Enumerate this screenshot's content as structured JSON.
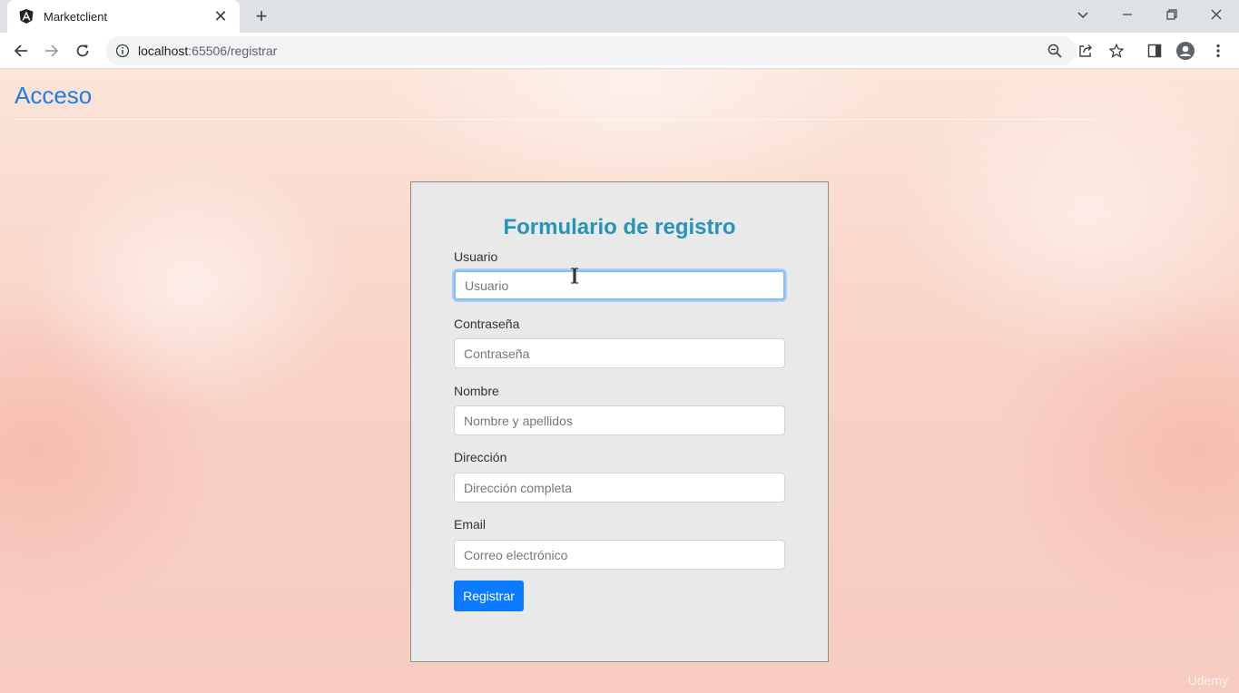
{
  "browser": {
    "tab_title": "Marketclient",
    "tab_close": "✕",
    "new_tab": "+",
    "url_host": "localhost",
    "url_rest": ":65506/registrar"
  },
  "nav": {
    "brand_link": "Acceso"
  },
  "form": {
    "title": "Formulario de registro",
    "fields": [
      {
        "label": "Usuario",
        "placeholder": "Usuario",
        "value": ""
      },
      {
        "label": "Contraseña",
        "placeholder": "Contraseña",
        "value": ""
      },
      {
        "label": "Nombre",
        "placeholder": "Nombre y apellidos",
        "value": ""
      },
      {
        "label": "Dirección",
        "placeholder": "Dirección completa",
        "value": ""
      },
      {
        "label": "Email",
        "placeholder": "Correo electrónico",
        "value": ""
      }
    ],
    "submit_label": "Registrar"
  },
  "watermark": "Udemy",
  "colors": {
    "accent": "#0d7bff",
    "title": "#2694b8",
    "link": "#1e7ee6"
  }
}
